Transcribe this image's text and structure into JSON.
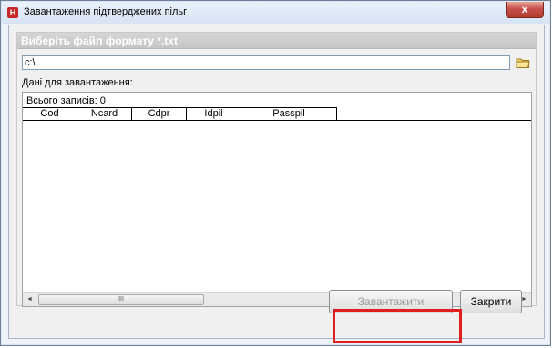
{
  "window": {
    "title": "Завантаження підтверджених пільг",
    "close_glyph": "x"
  },
  "group": {
    "header": "Виберіть файл формату *.txt"
  },
  "path": {
    "value": "c:\\"
  },
  "data_label": "Дані для завантаження:",
  "grid": {
    "count_text": "Всього записів: 0",
    "columns": [
      "Cod",
      "Ncard",
      "Cdpr",
      "Idpil",
      "Passpil"
    ],
    "rows": []
  },
  "scrollbar": {
    "left_arrow": "◄",
    "right_arrow": "►",
    "thumb_grip": "III"
  },
  "buttons": {
    "load_label": "Завантажити",
    "close_label": "Закрити"
  }
}
